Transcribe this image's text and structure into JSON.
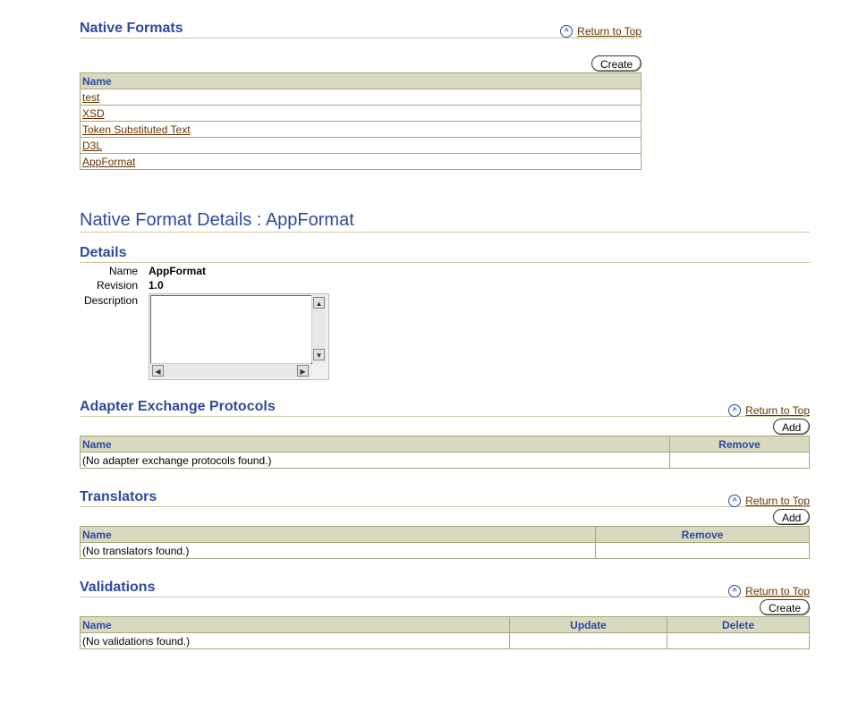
{
  "native_formats": {
    "title": "Native Formats",
    "return_to_top": "Return to Top",
    "create_label": "Create",
    "column_name": "Name",
    "rows": [
      "test",
      "XSD",
      "Token Substituted Text",
      "D3L",
      "AppFormat"
    ]
  },
  "details_page": {
    "title": "Native Format Details : AppFormat",
    "details_title": "Details",
    "name_label": "Name",
    "name_value": "AppFormat",
    "revision_label": "Revision",
    "revision_value": "1.0",
    "description_label": "Description",
    "description_value": ""
  },
  "adapter_protocols": {
    "title": "Adapter Exchange Protocols",
    "return_to_top": "Return to Top",
    "add_label": "Add",
    "columns": [
      "Name",
      "Remove"
    ],
    "empty": "(No adapter exchange protocols found.)"
  },
  "translators": {
    "title": "Translators",
    "return_to_top": "Return to Top",
    "add_label": "Add",
    "columns": [
      "Name",
      "Remove"
    ],
    "empty": "(No translators found.)"
  },
  "validations": {
    "title": "Validations",
    "return_to_top": "Return to Top",
    "create_label": "Create",
    "columns": [
      "Name",
      "Update",
      "Delete"
    ],
    "empty": "(No validations found.)"
  },
  "colors": {
    "heading_blue": "#2e4a9e",
    "link_brown": "#663300",
    "table_header_bg": "#d9d9c2",
    "table_border": "#a7a77a"
  }
}
